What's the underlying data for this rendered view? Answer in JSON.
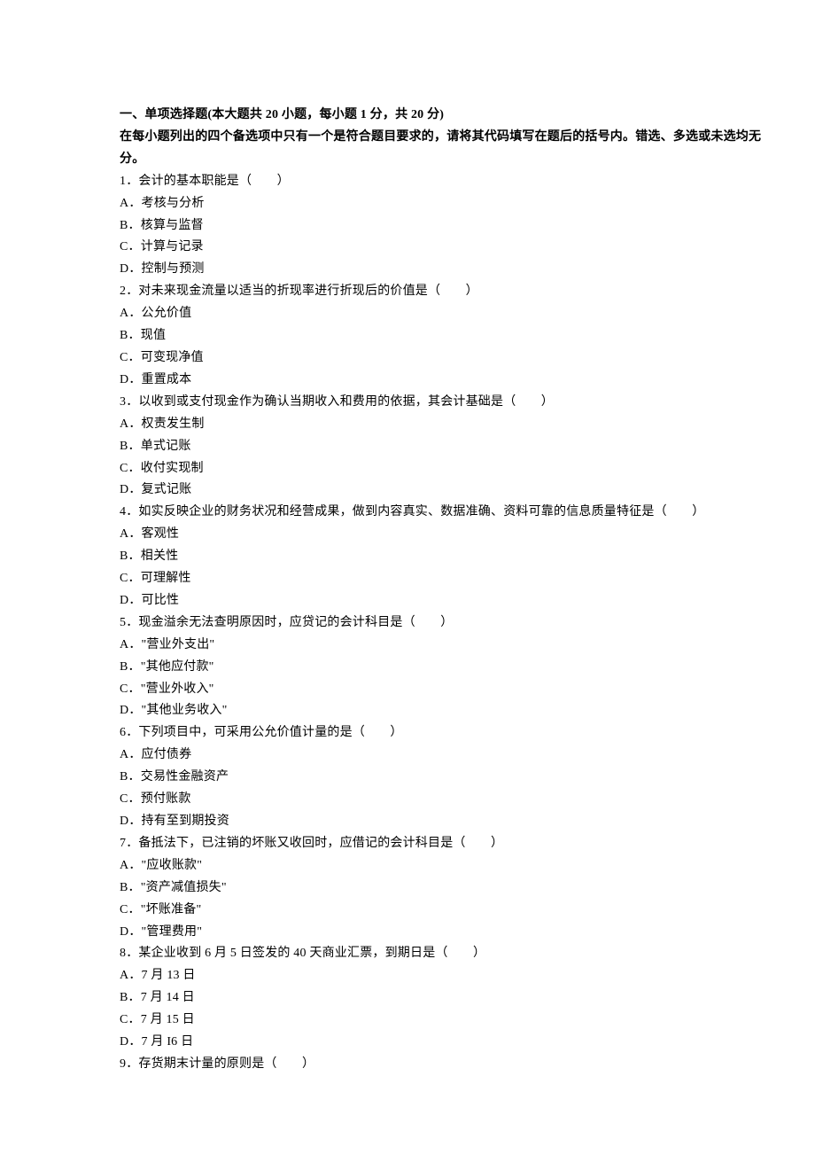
{
  "section": {
    "title_prefix": "一、单项选择题",
    "title_detail": "(本大题共 20 小题，每小题 1 分，共 20 分)",
    "instruction": "在每小题列出的四个备选项中只有一个是符合题目要求的，请将其代码填写在题后的括号内。错选、多选或未选均无分。"
  },
  "questions": [
    {
      "num": "1",
      "text": "会计的基本职能是（　　）",
      "options": [
        {
          "label": "A",
          "text": "考核与分析"
        },
        {
          "label": "B",
          "text": "核算与监督"
        },
        {
          "label": "C",
          "text": "计算与记录"
        },
        {
          "label": "D",
          "text": "控制与预测"
        }
      ]
    },
    {
      "num": "2",
      "text": "对未来现金流量以适当的折现率进行折现后的价值是（　　）",
      "options": [
        {
          "label": "A",
          "text": "公允价值"
        },
        {
          "label": "B",
          "text": "现值"
        },
        {
          "label": "C",
          "text": "可变现净值"
        },
        {
          "label": "D",
          "text": "重置成本"
        }
      ]
    },
    {
      "num": "3",
      "text": "以收到或支付现金作为确认当期收入和费用的依据，其会计基础是（　　）",
      "options": [
        {
          "label": "A",
          "text": "权责发生制"
        },
        {
          "label": "B",
          "text": "单式记账"
        },
        {
          "label": "C",
          "text": "收付实现制"
        },
        {
          "label": "D",
          "text": "复式记账"
        }
      ]
    },
    {
      "num": "4",
      "text": "如实反映企业的财务状况和经营成果，做到内容真实、数据准确、资料可靠的信息质量特征是（　　）",
      "options": [
        {
          "label": "A",
          "text": "客观性"
        },
        {
          "label": "B",
          "text": "相关性"
        },
        {
          "label": "C",
          "text": "可理解性"
        },
        {
          "label": "D",
          "text": "可比性"
        }
      ]
    },
    {
      "num": "5",
      "text": "现金溢余无法查明原因时，应贷记的会计科目是（　　）",
      "options": [
        {
          "label": "A",
          "text": "\"营业外支出\""
        },
        {
          "label": "B",
          "text": "\"其他应付款\""
        },
        {
          "label": "C",
          "text": "\"营业外收入\""
        },
        {
          "label": "D",
          "text": "\"其他业务收入\""
        }
      ]
    },
    {
      "num": "6",
      "text": "下列项目中，可采用公允价值计量的是（　　）",
      "options": [
        {
          "label": "A",
          "text": "应付债券"
        },
        {
          "label": "B",
          "text": "交易性金融资产"
        },
        {
          "label": "C",
          "text": "预付账款"
        },
        {
          "label": "D",
          "text": "持有至到期投资"
        }
      ]
    },
    {
      "num": "7",
      "text": "备抵法下，已注销的坏账又收回时，应借记的会计科目是（　　）",
      "options": [
        {
          "label": "A",
          "text": "\"应收账款\""
        },
        {
          "label": "B",
          "text": "\"资产减值损失\""
        },
        {
          "label": "C",
          "text": "\"坏账准备\""
        },
        {
          "label": "D",
          "text": "\"管理费用\""
        }
      ]
    },
    {
      "num": "8",
      "text": "某企业收到 6 月 5 日签发的 40 天商业汇票，到期日是（　　）",
      "options": [
        {
          "label": "A",
          "text": "7 月 13 日"
        },
        {
          "label": "B",
          "text": "7 月 14 日"
        },
        {
          "label": "C",
          "text": "7 月 15 日"
        },
        {
          "label": "D",
          "text": "7 月 I6 日"
        }
      ]
    },
    {
      "num": "9",
      "text": "存货期末计量的原则是（　　）",
      "options": []
    }
  ]
}
